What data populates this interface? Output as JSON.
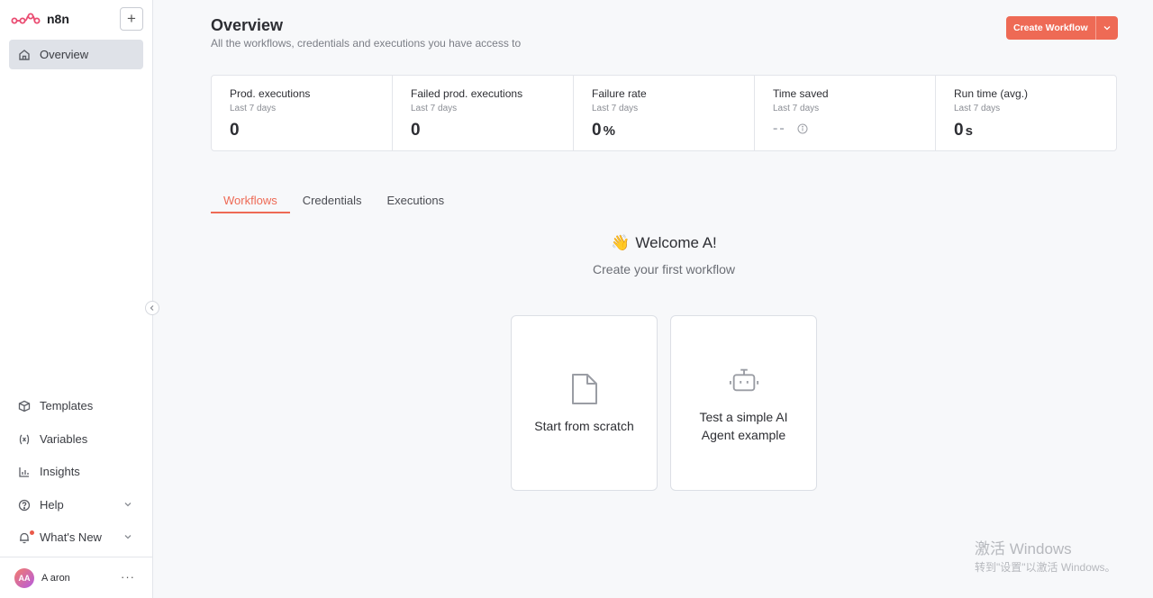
{
  "brand": {
    "name": "n8n"
  },
  "sidebar": {
    "nav": [
      {
        "label": "Overview",
        "icon": "home-icon",
        "active": true
      }
    ],
    "bottom_items": [
      {
        "label": "Templates",
        "icon": "box-icon"
      },
      {
        "label": "Variables",
        "icon": "variable-icon"
      },
      {
        "label": "Insights",
        "icon": "chart-icon"
      },
      {
        "label": "Help",
        "icon": "help-icon"
      },
      {
        "label": "What's New",
        "icon": "bell-icon"
      }
    ],
    "user": {
      "initials": "AA",
      "name": "A aron"
    },
    "more_label": "···"
  },
  "header": {
    "title": "Overview",
    "subtitle": "All the workflows, credentials and executions you have access to",
    "create_label": "Create Workflow",
    "accent_color": "#ee6a55"
  },
  "stats": [
    {
      "label": "Prod. executions",
      "period": "Last 7 days",
      "value": "0",
      "unit": ""
    },
    {
      "label": "Failed prod. executions",
      "period": "Last 7 days",
      "value": "0",
      "unit": ""
    },
    {
      "label": "Failure rate",
      "period": "Last 7 days",
      "value": "0",
      "unit": "%"
    },
    {
      "label": "Time saved",
      "period": "Last 7 days",
      "value": "--",
      "unit": ""
    },
    {
      "label": "Run time (avg.)",
      "period": "Last 7 days",
      "value": "0",
      "unit": "s"
    }
  ],
  "tabs": [
    {
      "label": "Workflows",
      "active": true
    },
    {
      "label": "Credentials",
      "active": false
    },
    {
      "label": "Executions",
      "active": false
    }
  ],
  "welcome": {
    "emoji": "👋",
    "title": "Welcome A!",
    "subtitle": "Create your first workflow"
  },
  "cards": [
    {
      "label": "Start from scratch",
      "icon": "file-icon"
    },
    {
      "label": "Test a simple AI Agent example",
      "icon": "robot-icon"
    }
  ],
  "watermark": {
    "line1": "激活 Windows",
    "line2": "转到\"设置\"以激活 Windows。"
  }
}
